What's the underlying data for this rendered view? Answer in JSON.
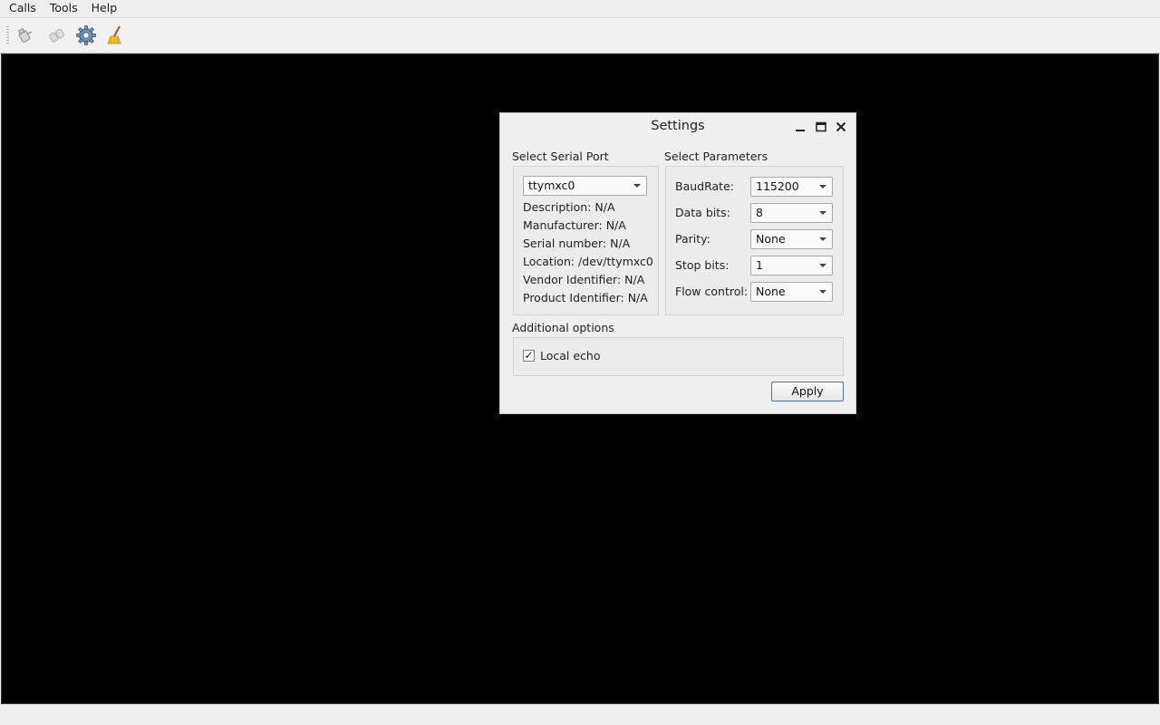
{
  "menubar": {
    "items": [
      "Calls",
      "Tools",
      "Help"
    ]
  },
  "toolbar": {
    "buttons": [
      "connect-icon",
      "disconnect-icon",
      "settings-gear-icon",
      "clear-broom-icon"
    ]
  },
  "dialog": {
    "title": "Settings",
    "serial_port": {
      "group_label": "Select Serial Port",
      "selected_port": "ttymxc0",
      "description": "Description: N/A",
      "manufacturer": "Manufacturer: N/A",
      "serial_number": "Serial number: N/A",
      "location": "Location: /dev/ttymxc0",
      "vendor_id": "Vendor Identifier: N/A",
      "product_id": "Product Identifier: N/A"
    },
    "parameters": {
      "group_label": "Select Parameters",
      "baud_label": "BaudRate:",
      "baud_value": "115200",
      "data_bits_label": "Data bits:",
      "data_bits_value": "8",
      "parity_label": "Parity:",
      "parity_value": "None",
      "stop_bits_label": "Stop bits:",
      "stop_bits_value": "1",
      "flow_label": "Flow control:",
      "flow_value": "None"
    },
    "additional": {
      "group_label": "Additional options",
      "local_echo_label": "Local echo",
      "local_echo_checked": true,
      "check_mark": "✓"
    },
    "apply_label": "Apply"
  }
}
